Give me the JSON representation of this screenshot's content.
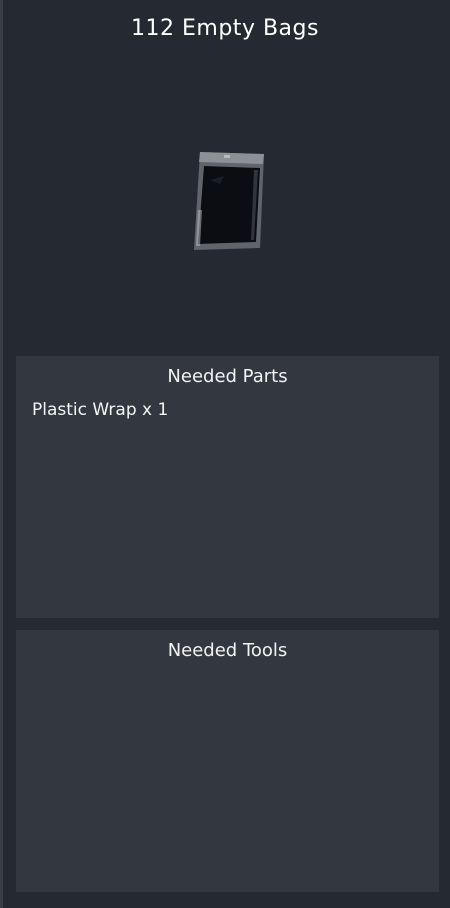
{
  "item": {
    "title": "112 Empty Bags",
    "image_icon": "empty-bag-icon"
  },
  "needed_parts": {
    "heading": "Needed Parts",
    "items": [
      {
        "label": "Plastic Wrap x 1"
      }
    ]
  },
  "needed_tools": {
    "heading": "Needed Tools",
    "items": []
  },
  "colors": {
    "background": "#252932",
    "panel": "#333740",
    "text": "#ffffff"
  }
}
